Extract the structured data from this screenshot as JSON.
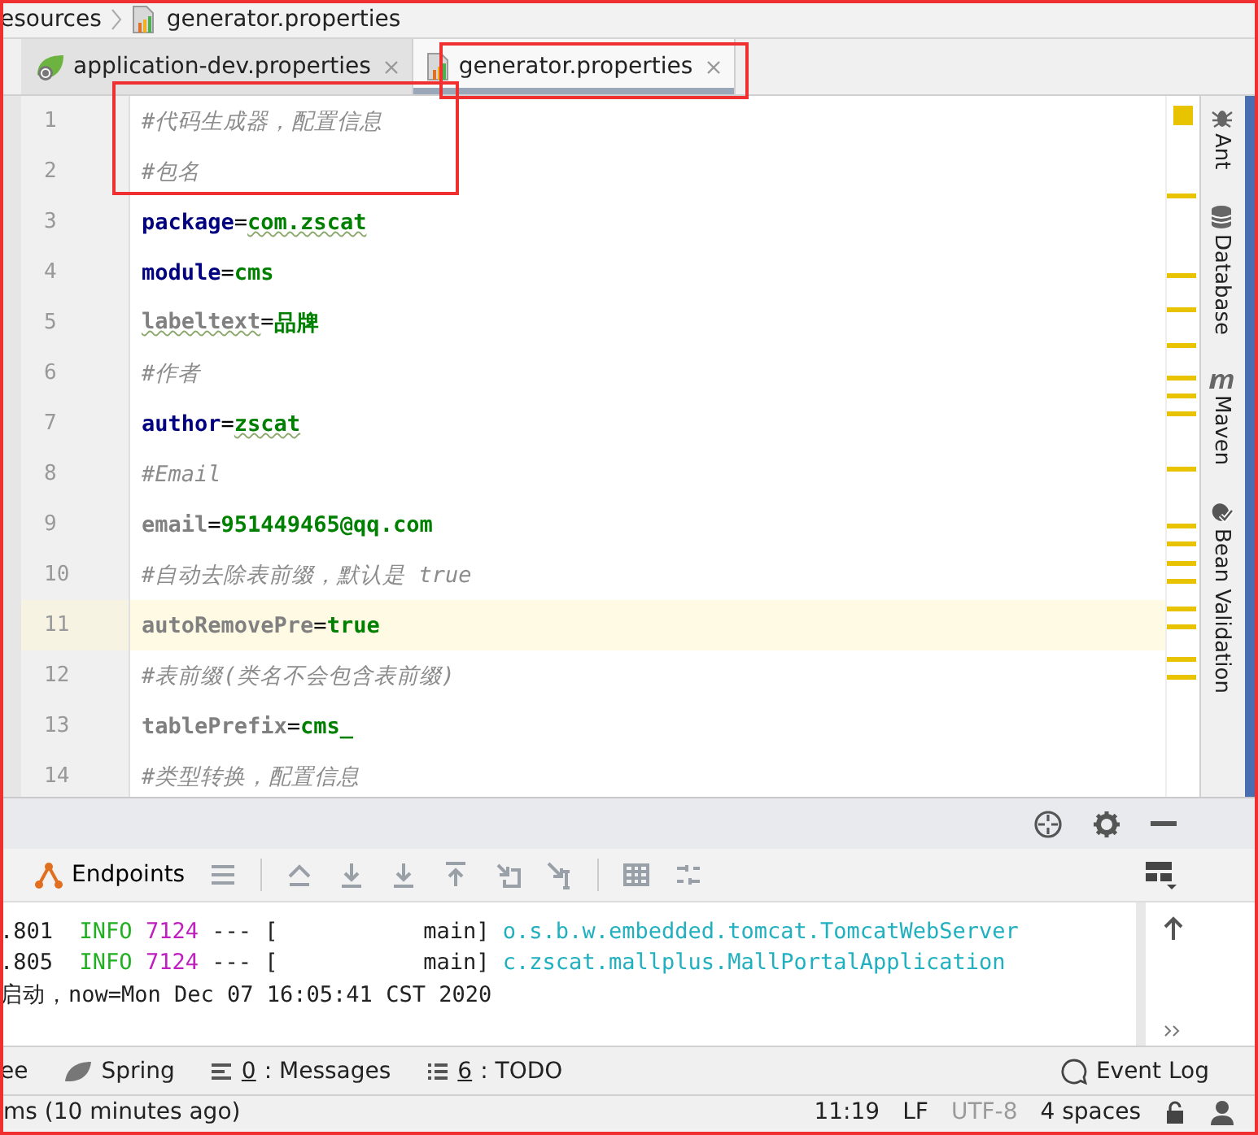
{
  "breadcrumb": [
    {
      "label": "esources",
      "kind": "folder"
    },
    {
      "label": "generator.properties",
      "kind": "properties"
    }
  ],
  "tabs": [
    {
      "label": "application-dev.properties",
      "kind": "spring",
      "selected": false
    },
    {
      "label": "generator.properties",
      "kind": "properties",
      "selected": true
    }
  ],
  "editor": {
    "lines": [
      {
        "number": "1",
        "kind": "comment",
        "text": "#代码生成器，配置信息",
        "selected": false
      },
      {
        "number": "2",
        "kind": "comment",
        "text": "#包名",
        "selected": false
      },
      {
        "number": "3",
        "kind": "property",
        "key": "package",
        "sep": "=",
        "value": "com.zscat",
        "unused": false,
        "typo": true,
        "selected": false
      },
      {
        "number": "4",
        "kind": "property",
        "key": "module",
        "sep": "=",
        "value": "cms",
        "unused": false,
        "typo": false,
        "selected": false
      },
      {
        "number": "5",
        "kind": "property",
        "key": "labeltext",
        "sep": "=",
        "value": "品牌",
        "unused": true,
        "typo": false,
        "key_typo": true,
        "selected": false
      },
      {
        "number": "6",
        "kind": "comment",
        "text": "#作者",
        "selected": false
      },
      {
        "number": "7",
        "kind": "property",
        "key": "author",
        "sep": "=",
        "value": "zscat",
        "unused": false,
        "typo": true,
        "selected": false
      },
      {
        "number": "8",
        "kind": "comment",
        "text": "#Email",
        "selected": false
      },
      {
        "number": "9",
        "kind": "property",
        "key": "email",
        "sep": "=",
        "value": "951449465@qq.com",
        "unused": true,
        "typo": false,
        "selected": false
      },
      {
        "number": "10",
        "kind": "comment",
        "text": "#自动去除表前缀，默认是 true",
        "selected": false
      },
      {
        "number": "11",
        "kind": "property",
        "key": "autoRemovePre",
        "sep": "=",
        "value": "true",
        "unused": true,
        "typo": false,
        "selected": true
      },
      {
        "number": "12",
        "kind": "comment",
        "text": "#表前缀(类名不会包含表前缀)",
        "selected": false
      },
      {
        "number": "13",
        "kind": "property",
        "key": "tablePrefix",
        "sep": "=",
        "value": "cms_",
        "unused": true,
        "typo": false,
        "selected": false
      },
      {
        "number": "14",
        "kind": "comment",
        "text": "#类型转换，配置信息",
        "selected": false
      }
    ]
  },
  "right_tools": [
    {
      "label": "Ant",
      "kind": "ant"
    },
    {
      "label": "Database",
      "kind": "database"
    },
    {
      "label": "Maven",
      "kind": "maven"
    },
    {
      "label": "Bean Validation",
      "kind": "bean"
    }
  ],
  "run_panel": {
    "tab": "Endpoints"
  },
  "console": {
    "lines": [
      {
        "kind": "log",
        "time": ".801",
        "level": "INFO",
        "pid": "7124",
        "thread": "--- [           main]",
        "logger": "o.s.b.w.embedded.tomcat.TomcatWebServer"
      },
      {
        "kind": "log",
        "time": ".805",
        "level": "INFO",
        "pid": "7124",
        "thread": "--- [           main]",
        "logger": "c.zscat.mallplus.MallPortalApplication"
      },
      {
        "kind": "plain",
        "text": "启动，now=Mon Dec 07 16:05:41 CST 2020"
      }
    ]
  },
  "tool_windows": [
    {
      "label": "ee",
      "kind": "plain"
    },
    {
      "label": "Spring",
      "kind": "spring"
    },
    {
      "mnemonic": "0",
      "label": ": Messages",
      "kind": "messages"
    },
    {
      "mnemonic": "6",
      "label": ": TODO",
      "kind": "todo"
    }
  ],
  "event_log": "Event Log",
  "status_bar": {
    "message": "ms (10 minutes ago)",
    "position": "11:19",
    "line_separator": "LF",
    "encoding": {
      "label": "UTF-8",
      "disabled": true
    },
    "indent": "4 spaces"
  }
}
